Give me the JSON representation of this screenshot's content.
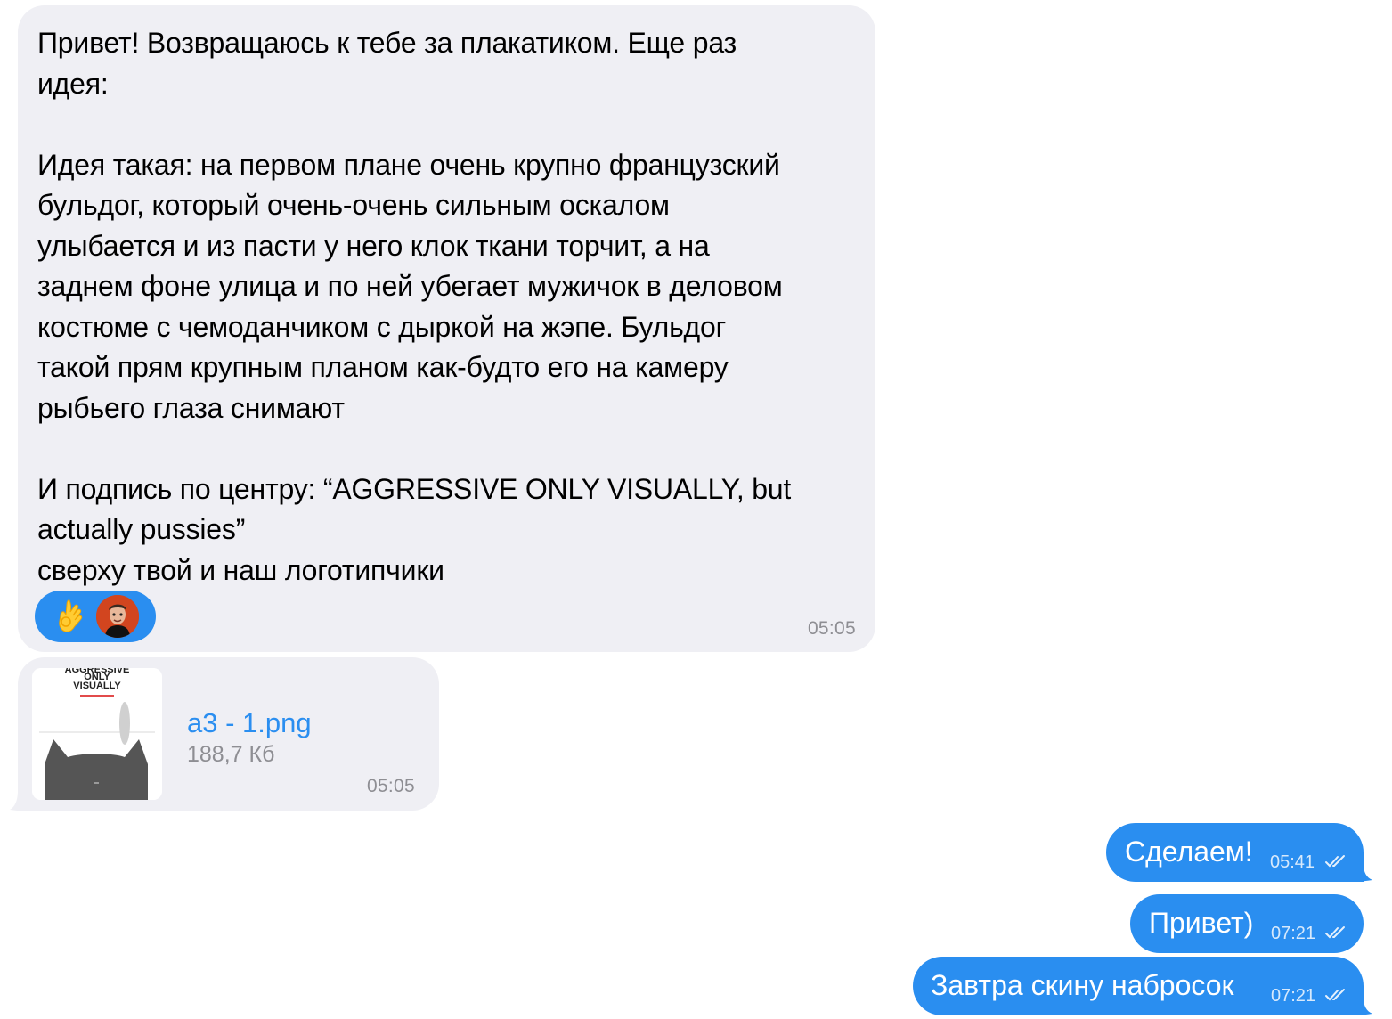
{
  "messages": {
    "m1": {
      "text": "Привет! Возвращаюсь к тебе за плакатиком. Еще раз\nидея:\n\nИдея такая: на первом плане очень крупно французский\nбульдог, который очень-очень сильным оскалом\nулыбается и из пасти у него клок ткани торчит, а на\nзаднем фоне улица и по ней убегает мужичок в деловом\nкостюме с чемоданчиком с дыркой на жэпе. Бульдог\nтакой прям крупным планом как-будто его на камеру\nрыбьего глаза снимают\n\nИ подпись по центру: “AGGRESSIVE ONLY VISUALLY, but\nactually pussies”\nсверху твой и наш логотипчики",
      "time": "05:05",
      "reactions": [
        "ok-hand-emoji",
        "user-avatar"
      ]
    },
    "m2": {
      "file_name": "a3 - 1.png",
      "file_size": "188,7 Кб",
      "time": "05:05",
      "thumb_lines": [
        "AGGRESSIVE",
        "ONLY",
        "VISUALLY"
      ]
    },
    "m3": {
      "text": "Сделаем!",
      "time": "05:41"
    },
    "m4": {
      "text": "Привет)",
      "time": "07:21"
    },
    "m5": {
      "text": "Завтра скину набросок",
      "time": "07:21"
    }
  },
  "colors": {
    "incoming_bg": "#efeff4",
    "outgoing_bg": "#2a8ef0",
    "accent": "#2a8ef0",
    "meta_gray": "#8e8e93"
  },
  "icons": {
    "read_receipt": "double-check-icon"
  }
}
